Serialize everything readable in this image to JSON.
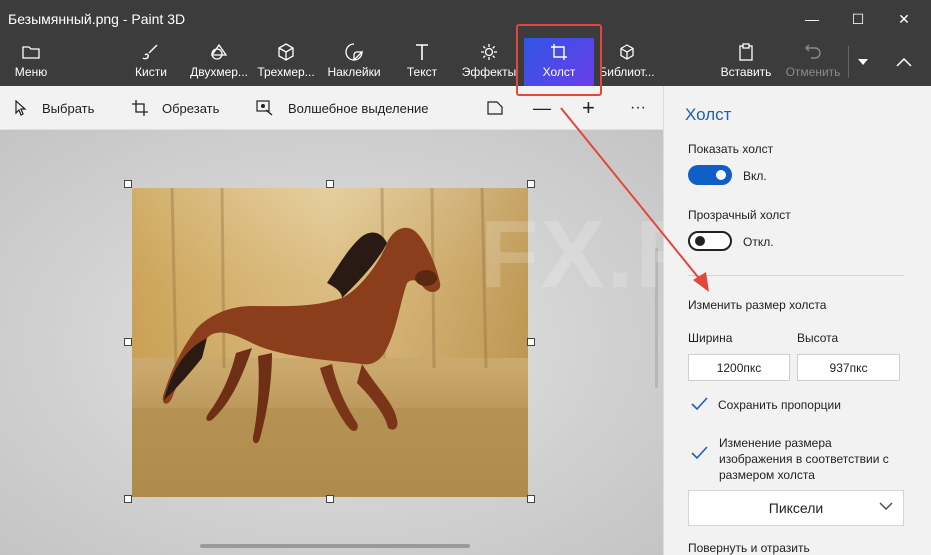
{
  "window": {
    "title": "Безымянный.png - Paint 3D",
    "controls": {
      "minimize": "—",
      "maximize": "☐",
      "close": "✕"
    }
  },
  "toolbar": {
    "menu": "Меню",
    "brushes": "Кисти",
    "shapes2d": "Двухмер...",
    "shapes3d": "Трехмер...",
    "stickers": "Наклейки",
    "text": "Текст",
    "effects": "Эффекты",
    "canvas": "Холст",
    "library": "Библиот...",
    "paste": "Вставить",
    "undo": "Отменить"
  },
  "subbar": {
    "select": "Выбрать",
    "crop": "Обрезать",
    "magic_select": "Волшебное выделение",
    "zoom_out": "—",
    "zoom_in": "+",
    "more": "···"
  },
  "panel": {
    "title": "Холст",
    "show_canvas_label": "Показать холст",
    "show_canvas_state": "Вкл.",
    "transparent_label": "Прозрачный холст",
    "transparent_state": "Откл.",
    "resize_title": "Изменить размер холста",
    "width_label": "Ширина",
    "height_label": "Высота",
    "width_value": "1200пкс",
    "height_value": "937пкс",
    "keep_ratio": "Сохранить пропорции",
    "resize_image_line1": "Изменение размера",
    "resize_image_line2": "изображения в соответствии с",
    "resize_image_line3": "размером холста",
    "units": "Пиксели",
    "rotate_flip": "Повернуть и отразить"
  },
  "watermark": "FX.RU",
  "colors": {
    "accent": "#0f5fc6",
    "titlebar": "#3c3c3c",
    "annotation": "#e3473b"
  }
}
